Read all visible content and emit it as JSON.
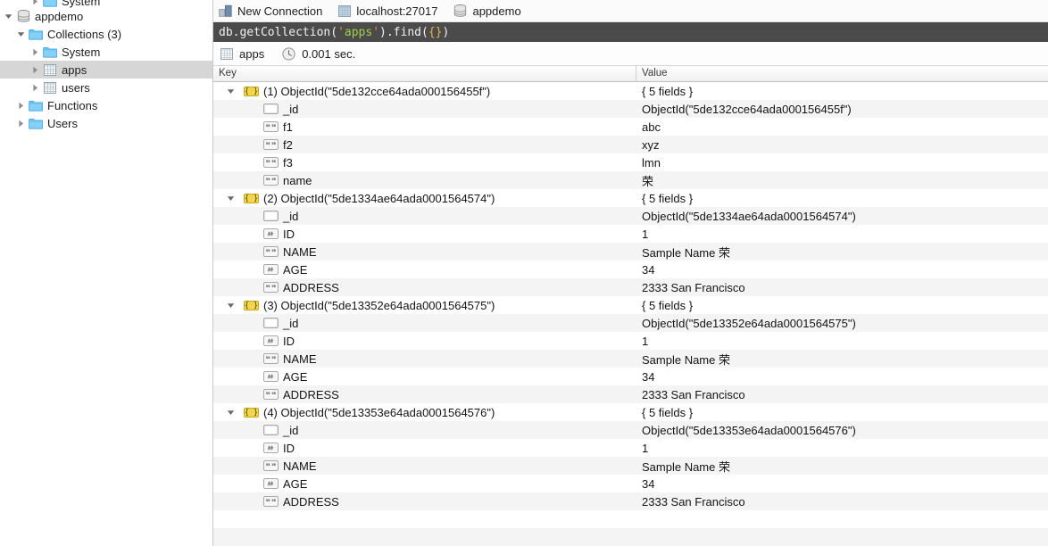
{
  "sidebar": {
    "items": [
      {
        "label": "System",
        "depth": 2,
        "icon": "folder-icon",
        "twisty": "collapsed",
        "selected": false,
        "clipped": true
      },
      {
        "label": "appdemo",
        "depth": 0,
        "icon": "database-icon",
        "twisty": "expanded",
        "selected": false
      },
      {
        "label": "Collections (3)",
        "depth": 1,
        "icon": "folder-icon",
        "twisty": "expanded",
        "selected": false
      },
      {
        "label": "System",
        "depth": 2,
        "icon": "folder-icon",
        "twisty": "collapsed",
        "selected": false
      },
      {
        "label": "apps",
        "depth": 2,
        "icon": "collection-icon",
        "twisty": "collapsed",
        "selected": true
      },
      {
        "label": "users",
        "depth": 2,
        "icon": "collection-icon",
        "twisty": "collapsed",
        "selected": false
      },
      {
        "label": "Functions",
        "depth": 1,
        "icon": "folder-icon",
        "twisty": "collapsed",
        "selected": false
      },
      {
        "label": "Users",
        "depth": 1,
        "icon": "folder-icon",
        "twisty": "collapsed",
        "selected": false
      }
    ]
  },
  "breadcrumbs": [
    {
      "label": "New Connection",
      "icon": "connection-icon"
    },
    {
      "label": "localhost:27017",
      "icon": "server-icon"
    },
    {
      "label": "appdemo",
      "icon": "database-icon"
    }
  ],
  "query": {
    "prefix": "db.getCollection(",
    "quote_open": "'",
    "collection": "apps",
    "quote_close": "'",
    "mid": ").find(",
    "braces": "{}",
    "suffix": ")",
    "full": "db.getCollection('apps').find({})"
  },
  "status": {
    "collection_label": "apps",
    "collection_icon": "collection-icon",
    "time_icon": "clock-icon",
    "time_label": "0.001 sec."
  },
  "table": {
    "columns": [
      "Key",
      "Value"
    ],
    "rows": [
      {
        "key": "(1) ObjectId(\"5de132cce64ada000156455f\")",
        "value": "{ 5 fields }",
        "icon": "object-icon",
        "level": 0,
        "twisty": "expanded"
      },
      {
        "key": "_id",
        "value": "ObjectId(\"5de132cce64ada000156455f\")",
        "icon": "objectid-icon",
        "level": 1,
        "twisty": "none"
      },
      {
        "key": "f1",
        "value": "abc",
        "icon": "string-icon",
        "level": 1,
        "twisty": "none"
      },
      {
        "key": "f2",
        "value": "xyz",
        "icon": "string-icon",
        "level": 1,
        "twisty": "none"
      },
      {
        "key": "f3",
        "value": "lmn",
        "icon": "string-icon",
        "level": 1,
        "twisty": "none"
      },
      {
        "key": "name",
        "value": "荣",
        "icon": "string-icon",
        "level": 1,
        "twisty": "none"
      },
      {
        "key": "(2) ObjectId(\"5de1334ae64ada0001564574\")",
        "value": "{ 5 fields }",
        "icon": "object-icon",
        "level": 0,
        "twisty": "expanded"
      },
      {
        "key": "_id",
        "value": "ObjectId(\"5de1334ae64ada0001564574\")",
        "icon": "objectid-icon",
        "level": 1,
        "twisty": "none"
      },
      {
        "key": "ID",
        "value": "1",
        "icon": "number-icon",
        "level": 1,
        "twisty": "none"
      },
      {
        "key": "NAME",
        "value": "Sample Name 荣",
        "icon": "string-icon",
        "level": 1,
        "twisty": "none"
      },
      {
        "key": "AGE",
        "value": "34",
        "icon": "number-icon",
        "level": 1,
        "twisty": "none"
      },
      {
        "key": "ADDRESS",
        "value": "2333 San Francisco",
        "icon": "string-icon",
        "level": 1,
        "twisty": "none"
      },
      {
        "key": "(3) ObjectId(\"5de13352e64ada0001564575\")",
        "value": "{ 5 fields }",
        "icon": "object-icon",
        "level": 0,
        "twisty": "expanded"
      },
      {
        "key": "_id",
        "value": "ObjectId(\"5de13352e64ada0001564575\")",
        "icon": "objectid-icon",
        "level": 1,
        "twisty": "none"
      },
      {
        "key": "ID",
        "value": "1",
        "icon": "number-icon",
        "level": 1,
        "twisty": "none"
      },
      {
        "key": "NAME",
        "value": "Sample Name 荣",
        "icon": "string-icon",
        "level": 1,
        "twisty": "none"
      },
      {
        "key": "AGE",
        "value": "34",
        "icon": "number-icon",
        "level": 1,
        "twisty": "none"
      },
      {
        "key": "ADDRESS",
        "value": "2333 San Francisco",
        "icon": "string-icon",
        "level": 1,
        "twisty": "none"
      },
      {
        "key": "(4) ObjectId(\"5de13353e64ada0001564576\")",
        "value": "{ 5 fields }",
        "icon": "object-icon",
        "level": 0,
        "twisty": "expanded"
      },
      {
        "key": "_id",
        "value": "ObjectId(\"5de13353e64ada0001564576\")",
        "icon": "objectid-icon",
        "level": 1,
        "twisty": "none"
      },
      {
        "key": "ID",
        "value": "1",
        "icon": "number-icon",
        "level": 1,
        "twisty": "none"
      },
      {
        "key": "NAME",
        "value": "Sample Name 荣",
        "icon": "string-icon",
        "level": 1,
        "twisty": "none"
      },
      {
        "key": "AGE",
        "value": "34",
        "icon": "number-icon",
        "level": 1,
        "twisty": "none"
      },
      {
        "key": "ADDRESS",
        "value": "2333 San Francisco",
        "icon": "string-icon",
        "level": 1,
        "twisty": "none"
      }
    ]
  },
  "colors": {
    "selection": "#d6d6d6",
    "query_bg": "#4b4b4b",
    "query_string": "#9fd14a",
    "query_punct": "#e09b3a",
    "folder": "#6fc3f2",
    "row_stripe": "#f4f4f4",
    "object_icon": "#f2d64b"
  }
}
